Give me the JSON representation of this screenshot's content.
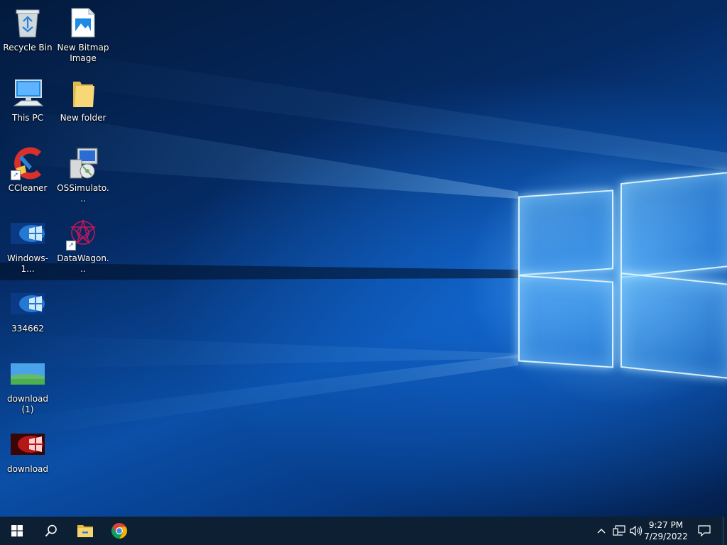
{
  "desktop": {
    "icons": [
      {
        "label": "Recycle Bin",
        "icon": "recycle-bin-icon"
      },
      {
        "label": "New Bitmap Image",
        "icon": "bitmap-file-icon"
      },
      {
        "label": "This PC",
        "icon": "computer-icon"
      },
      {
        "label": "New folder",
        "icon": "folder-icon"
      },
      {
        "label": "CCleaner",
        "icon": "ccleaner-icon",
        "shortcut": true
      },
      {
        "label": "OSSimulato...",
        "icon": "installer-icon"
      },
      {
        "label": "Windows-1...",
        "icon": "image-file-icon"
      },
      {
        "label": "DataWagon...",
        "icon": "datawagon-icon",
        "shortcut": true
      },
      {
        "label": "334662",
        "icon": "image-file-icon"
      },
      {
        "label": "download (1)",
        "icon": "image-file-icon"
      },
      {
        "label": "download",
        "icon": "image-file-icon"
      }
    ]
  },
  "taskbar": {
    "start": "windows-start-icon",
    "search": "search-icon",
    "pinned": [
      {
        "name": "File Explorer",
        "icon": "file-explorer-icon"
      },
      {
        "name": "Google Chrome",
        "icon": "chrome-icon"
      }
    ],
    "tray": {
      "chevron": "chevron-up-icon",
      "network": "network-icon",
      "volume": "volume-icon",
      "notifications": "notification-icon"
    },
    "clock": {
      "time": "9:27 PM",
      "date": "7/29/2022"
    }
  },
  "colors": {
    "taskbar_bg": "#0c1f33",
    "wallpaper_dark": "#031a3d",
    "wallpaper_bright": "#0a4fa8"
  }
}
